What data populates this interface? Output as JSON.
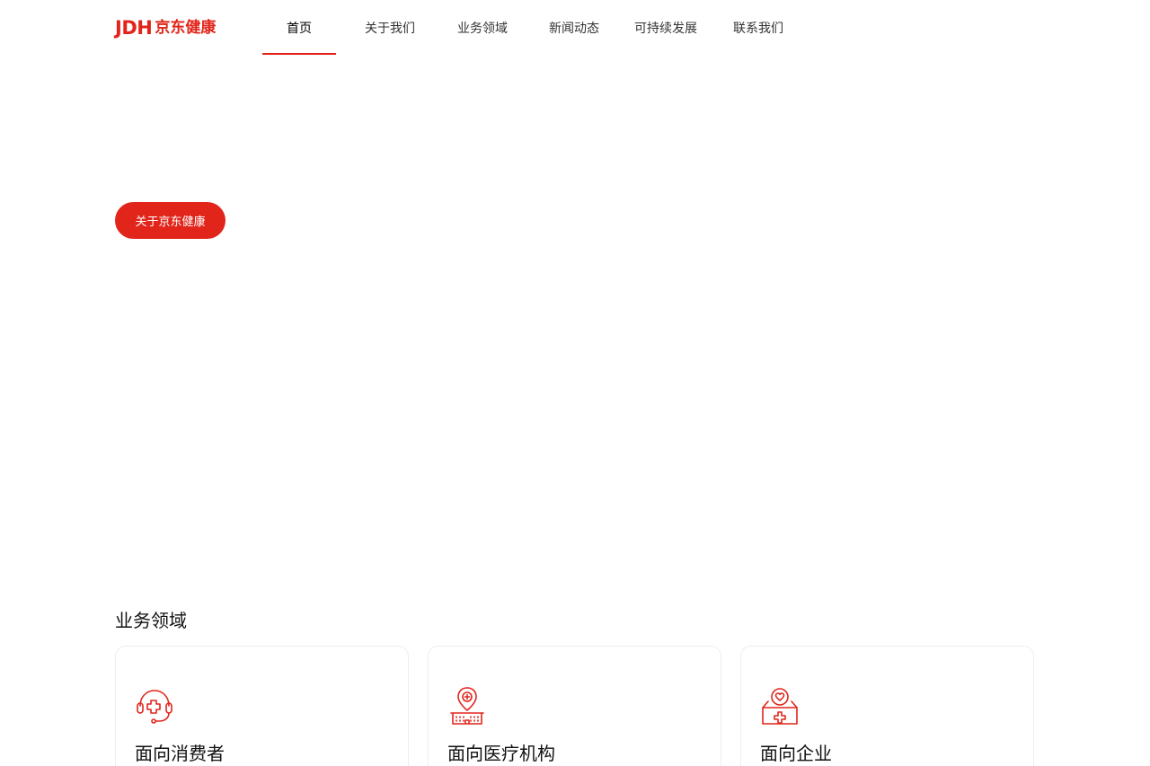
{
  "header": {
    "logo_mark": "JDH",
    "logo_text": "京东健康",
    "nav": [
      {
        "label": "首页",
        "active": true
      },
      {
        "label": "关于我们",
        "active": false
      },
      {
        "label": "业务领域",
        "active": false
      },
      {
        "label": "新闻动态",
        "active": false
      },
      {
        "label": "可持续发展",
        "active": false
      },
      {
        "label": "联系我们",
        "active": false
      }
    ]
  },
  "hero": {
    "button_label": "关于京东健康"
  },
  "business": {
    "title": "业务领域",
    "cards": [
      {
        "label": "面向消费者",
        "icon": "headset-medical-icon"
      },
      {
        "label": "面向医疗机构",
        "icon": "hospital-location-icon"
      },
      {
        "label": "面向企业",
        "icon": "heart-box-icon"
      }
    ]
  },
  "theme": {
    "accent": "#e1251b"
  }
}
